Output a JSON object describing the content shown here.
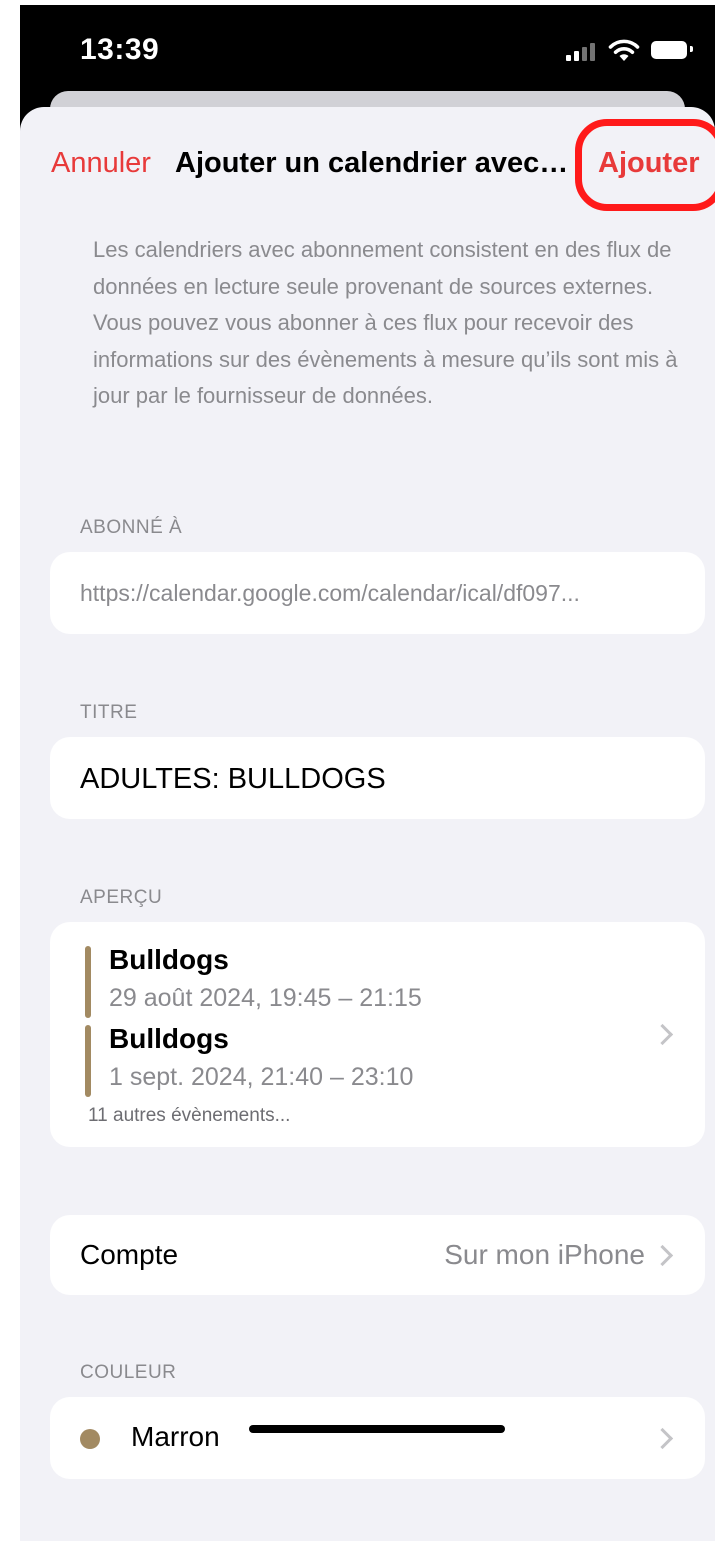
{
  "status_bar": {
    "time": "13:39",
    "icons": [
      "signal-icon",
      "wifi-icon",
      "battery-icon"
    ]
  },
  "nav": {
    "cancel_label": "Annuler",
    "title": "Ajouter un calendrier avec…",
    "add_label": "Ajouter"
  },
  "intro_text": "Les calendriers avec abonnement consistent en des flux de données en lecture seule provenant de sources externes. Vous pouvez vous abonner à ces flux pour recevoir des informations sur des évènements à mesure qu’ils sont mis à jour par le fournisseur de données.",
  "subscribed": {
    "section_label": "ABONNÉ À",
    "url": "https://calendar.google.com/calendar/ical/df097..."
  },
  "title_section": {
    "section_label": "TITRE",
    "value": "ADULTES: BULLDOGS"
  },
  "preview": {
    "section_label": "APERÇU",
    "events": [
      {
        "name": "Bulldogs",
        "date": "29 août 2024, 19:45 – 21:15"
      },
      {
        "name": "Bulldogs",
        "date": "1 sept. 2024, 21:40 – 23:10"
      }
    ],
    "more": "11 autres évènements..."
  },
  "account": {
    "label": "Compte",
    "value": "Sur mon iPhone"
  },
  "color": {
    "section_label": "COULEUR",
    "name": "Marron",
    "swatch": "#a28a62"
  },
  "colors": {
    "accent": "#e83a3a",
    "highlight_ring": "#ff1a1a",
    "background": "#f2f2f7"
  }
}
